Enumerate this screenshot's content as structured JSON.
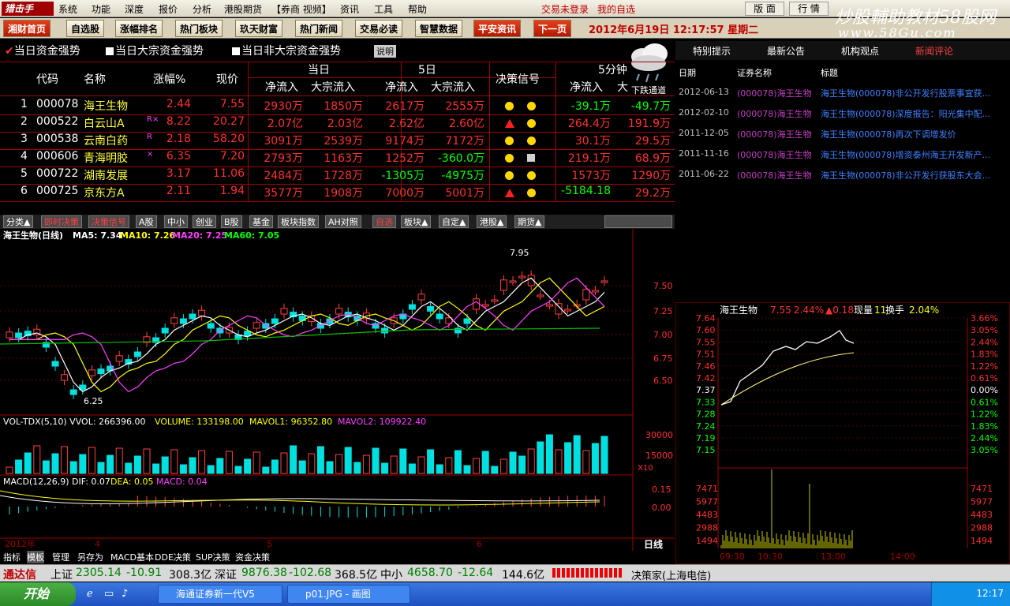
{
  "menu": {
    "logo": "猎击手",
    "items": [
      "系统",
      "功能",
      "深度",
      "报价",
      "分析",
      "港股期货",
      "【券商 视频】",
      "资讯",
      "工具",
      "帮助"
    ],
    "login_status": "交易未登录",
    "fav": "我的自选",
    "layout_btn": "版 面",
    "quote_btn": "行 情"
  },
  "nav": {
    "items": [
      "湘财首页",
      "自选股",
      "涨幅排名",
      "热门板块",
      "玖天财富",
      "热门新闻",
      "交易必读",
      "智慧数据",
      "平安资讯",
      "下一页"
    ],
    "date": "2012年6月19日",
    "time": "12:17:57",
    "weekday": "星期二"
  },
  "watermark": {
    "line1": "炒股輔助教材58股网",
    "line2": "www.58Gu.com"
  },
  "toptabs": {
    "tab1": "当日资金强势",
    "tab2": "当日大宗资金强势",
    "tab3": "当日非大宗资金强势",
    "explain": "说明",
    "weather_label": "下跌通道"
  },
  "table": {
    "headers": {
      "code": "代码",
      "name": "名称",
      "chg": "涨幅%",
      "price": "现价",
      "today": "当日",
      "net_in": "净流入",
      "block_in": "大宗流入",
      "d5": "5日",
      "net_in5": "净流入",
      "block_in5": "大宗流入",
      "signal": "决策信号",
      "m5": "5分钟",
      "net_m5": "净流入",
      "block_m5": "大"
    },
    "rows": [
      {
        "idx": "1",
        "code": "000078",
        "name": "海王生物",
        "flag": "",
        "chg": "2.44",
        "price": "7.55",
        "net": "2930万",
        "block": "1850万",
        "net5": "2617万",
        "block5": "2555万",
        "sig": [
          "dot",
          "dot"
        ],
        "netm": "-39.1万",
        "blockm": "-49.7万"
      },
      {
        "idx": "2",
        "code": "000522",
        "name": "白云山A",
        "flag": "R×",
        "chg": "8.22",
        "price": "20.27",
        "net": "2.07亿",
        "block": "2.03亿",
        "net5": "2.62亿",
        "block5": "2.60亿",
        "sig": [
          "tri",
          "dot"
        ],
        "netm": "264.4万",
        "blockm": "191.9万"
      },
      {
        "idx": "3",
        "code": "000538",
        "name": "云南白药",
        "flag": "R",
        "chg": "2.18",
        "price": "58.20",
        "net": "3091万",
        "block": "2539万",
        "net5": "9174万",
        "block5": "7172万",
        "sig": [
          "dot",
          "dot"
        ],
        "netm": "30.1万",
        "blockm": "29.5万"
      },
      {
        "idx": "4",
        "code": "000606",
        "name": "青海明胶",
        "flag": "×",
        "chg": "6.35",
        "price": "7.20",
        "net": "2793万",
        "block": "1163万",
        "net5": "1252万",
        "block5": "-360.0万",
        "sig": [
          "dot",
          "sq"
        ],
        "netm": "219.1万",
        "blockm": "68.9万"
      },
      {
        "idx": "5",
        "code": "000722",
        "name": "湖南发展",
        "flag": "",
        "chg": "3.17",
        "price": "11.06",
        "net": "2484万",
        "block": "1728万",
        "net5": "-1305万",
        "block5": "-4975万",
        "sig": [
          "dot",
          "dot"
        ],
        "netm": "1573万",
        "blockm": "1290万"
      },
      {
        "idx": "6",
        "code": "000725",
        "name": "京东方A",
        "flag": "",
        "chg": "2.11",
        "price": "1.94",
        "net": "3577万",
        "block": "1908万",
        "net5": "7000万",
        "block5": "5001万",
        "sig": [
          "tri",
          "dot"
        ],
        "netm": "-5184.18",
        "blockm": "29.2万"
      }
    ]
  },
  "tabrow": [
    "分类▲",
    "即时决策",
    "决策信号",
    "A股",
    "中小",
    "创业",
    "B股",
    "基金",
    "板块指数",
    "AH对照",
    "自选",
    "板块▲",
    "自定▲",
    "港股▲",
    "期货▲"
  ],
  "chart_labels": {
    "title": "海王生物(日线)",
    "ma5": "MA5: 7.34",
    "ma10": "MA10: 7.26",
    "ma20": "MA20: 7.25",
    "ma60": "MA60: 7.05",
    "high_label": "7.95",
    "low_label": "6.25",
    "yticks": [
      "7.50",
      "7.25",
      "7.00",
      "6.75",
      "6.50"
    ],
    "vol_title": "VOL-TDX(5,10)",
    "vvol": "VVOL: 266396.00",
    "volume": "VOLUME: 133198.00",
    "mavol1": "MAVOL1: 96352.80",
    "mavol2": "MAVOL2: 109922.40",
    "vol_ticks": [
      "30000",
      "15000",
      "X10"
    ],
    "macd_title": "MACD(12,26,9)",
    "dif": "DIF: 0.07",
    "dea": "DEA: 0.05",
    "macd": "MACD: 0.04",
    "macd_ticks": [
      "0.15",
      "0.00"
    ],
    "xlabels": [
      "2012年",
      "4",
      "5",
      "6"
    ],
    "period": "日线"
  },
  "btabs": [
    "指标",
    "模板",
    "管理",
    "另存为",
    "MACD基本",
    "DDE决策",
    "SUP决策",
    "资金决策"
  ],
  "right": {
    "tabs": [
      "特别提示",
      "最新公告",
      "机构观点",
      "新闻评论"
    ],
    "cols": {
      "date": "日期",
      "name": "证券名称",
      "title": "标题"
    },
    "news": [
      {
        "date": "2012-06-13",
        "name": "(000078)海王生物",
        "title": "海王生物(000078)非公开发行股票事宜获..."
      },
      {
        "date": "2012-02-10",
        "name": "(000078)海王生物",
        "title": "海王生物(000078)深度报告：阳光集中配..."
      },
      {
        "date": "2011-12-05",
        "name": "(000078)海王生物",
        "title": "海王生物(000078)再次下调增发价"
      },
      {
        "date": "2011-11-16",
        "name": "(000078)海王生物",
        "title": "海王生物(000078)增资泰州海王开发新产..."
      },
      {
        "date": "2011-06-22",
        "name": "(000078)海王生物",
        "title": "海王生物(000078)非公开发行获股东大会..."
      }
    ]
  },
  "mini": {
    "name": "海王生物",
    "price": "7.55",
    "pct": "2.44%",
    "chg": "▲0.18",
    "now": "现量",
    "now_val": "11",
    "turn": "换手",
    "turn_val": "2.04%",
    "yleft": [
      "7.64",
      "7.60",
      "7.55",
      "7.51",
      "7.46",
      "7.42",
      "7.37",
      "7.33",
      "7.28",
      "7.24",
      "7.19",
      "7.15",
      "7471",
      "5977",
      "4483",
      "2988",
      "1494"
    ],
    "yright": [
      "3.66%",
      "3.05%",
      "2.44%",
      "1.83%",
      "1.22%",
      "0.61%",
      "0.00%",
      "0.61%",
      "1.22%",
      "1.83%",
      "2.44%",
      "3.05%",
      "7471",
      "5977",
      "4483",
      "2988",
      "1494"
    ],
    "xticks": [
      "09:30",
      "10:30",
      "13:00",
      "14:00"
    ]
  },
  "statusbar": {
    "app": "通达信",
    "sh_label": "上证",
    "sh": "2305.14",
    "sh_chg": "-10.91",
    "sh_amt": "308.3亿",
    "sz_label": "深证",
    "sz": "9876.38",
    "sz_chg": "-102.68",
    "sz_amt": "368.5亿",
    "zx_label": "中小",
    "zx": "4658.70",
    "zx_chg": "-12.64",
    "zx_amt": "144.6亿",
    "source": "决策家(上海电信)"
  },
  "taskbar": {
    "start": "开始",
    "task1": "海通证券新一代V5",
    "task2": "p01.JPG - 画图",
    "clock": "12:17"
  },
  "chart_data": {
    "type": "candlestick",
    "ylim": [
      6.25,
      7.95
    ],
    "title": "海王生物(日线)"
  }
}
